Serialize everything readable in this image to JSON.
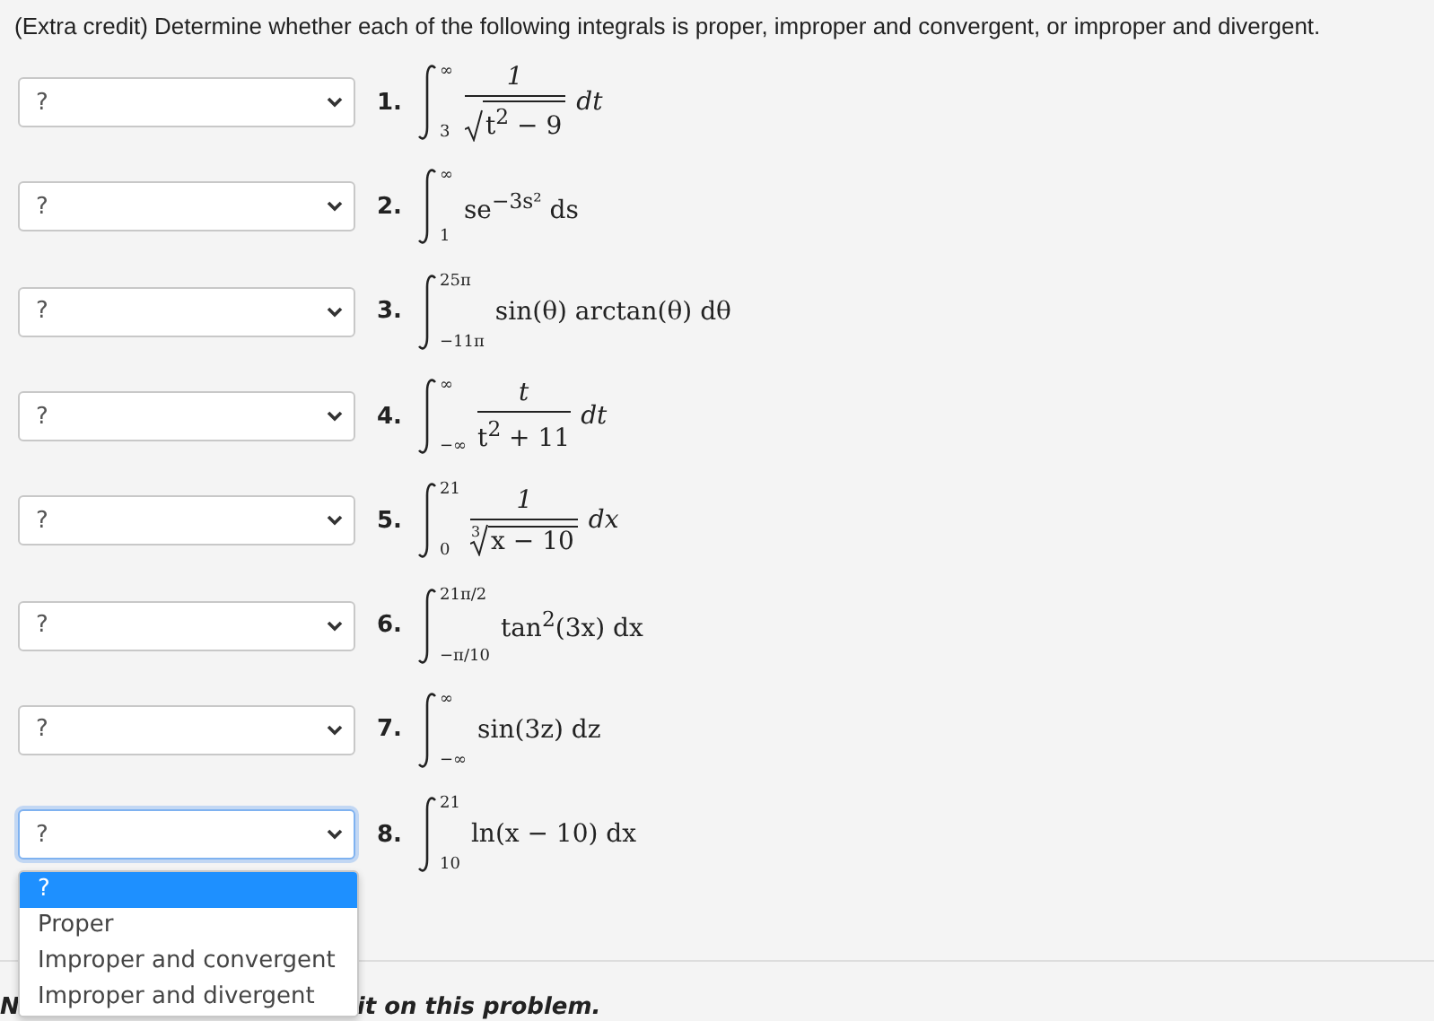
{
  "question": "(Extra credit) Determine whether each of the following integrals is proper, improper and convergent, or improper and divergent.",
  "problems": [
    {
      "number": "1.",
      "select": {
        "value": "?",
        "focused": false
      },
      "integral": {
        "upper": "∞",
        "lower": "3",
        "kind": "fraction",
        "numerator": "1",
        "denominator": {
          "radical": true,
          "radicand": "t$^{2}$ − 9"
        },
        "differential": "dt"
      }
    },
    {
      "number": "2.",
      "select": {
        "value": "?",
        "focused": false
      },
      "integral": {
        "upper": "∞",
        "lower": "1",
        "kind": "plain",
        "integrand": "se$^{−3s²}$ ds"
      }
    },
    {
      "number": "3.",
      "select": {
        "value": "?",
        "focused": false
      },
      "integral": {
        "upper": "25π",
        "lower": "−11π",
        "kind": "plain",
        "integrand": "sin(θ) arctan(θ) dθ"
      }
    },
    {
      "number": "4.",
      "select": {
        "value": "?",
        "focused": false
      },
      "integral": {
        "upper": "∞",
        "lower": "−∞",
        "kind": "fraction",
        "numerator": "t",
        "denominator": {
          "radical": false,
          "radicand": "t$^{2}$ + 11"
        },
        "differential": "dt"
      }
    },
    {
      "number": "5.",
      "select": {
        "value": "?",
        "focused": false
      },
      "integral": {
        "upper": "21",
        "lower": "0",
        "kind": "fraction",
        "numerator": "1",
        "denominator": {
          "radical": true,
          "index": "3",
          "radicand": "x − 10"
        },
        "differential": "dx"
      }
    },
    {
      "number": "6.",
      "select": {
        "value": "?",
        "focused": false
      },
      "integral": {
        "upper": "21π/2",
        "lower": "−π/10",
        "kind": "plain",
        "integrand": "tan$^{2}$(3x) dx"
      }
    },
    {
      "number": "7.",
      "select": {
        "value": "?",
        "focused": false
      },
      "integral": {
        "upper": "∞",
        "lower": "−∞",
        "kind": "plain",
        "integrand": "sin(3z) dz"
      }
    },
    {
      "number": "8.",
      "select": {
        "value": "?",
        "focused": true
      },
      "integral": {
        "upper": "21",
        "lower": "10",
        "kind": "plain",
        "integrand": "ln(x − 10) dx"
      }
    }
  ],
  "dropdown_options": [
    {
      "label": "?",
      "selected": true
    },
    {
      "label": "Proper",
      "selected": false
    },
    {
      "label": "Improper and convergent",
      "selected": false
    },
    {
      "label": "Improper and divergent",
      "selected": false
    }
  ],
  "note_visible_parts": [
    "N",
    "it on this problem."
  ]
}
